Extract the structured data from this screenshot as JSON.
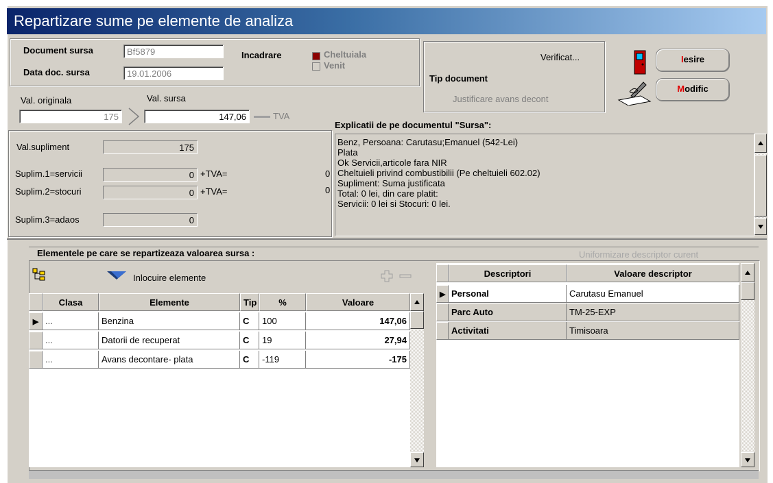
{
  "window": {
    "title": "Repartizare sume pe elemente de analiza"
  },
  "document": {
    "doc_source_label": "Document sursa",
    "doc_source_value": "Bf5879",
    "doc_date_label": "Data doc. sursa",
    "doc_date_value": "19.01.2006",
    "incadrare_label": "Incadrare",
    "option_cheltuiala": "Cheltuiala",
    "option_venit": "Venit"
  },
  "doctype": {
    "verificat": "Verificat...",
    "tip_label": "Tip document",
    "tip_value": "Justificare avans decont"
  },
  "buttons": {
    "iesire_hotkey": "I",
    "iesire_rest": "esire",
    "modific_hotkey": "M",
    "modific_rest": "odific"
  },
  "values": {
    "val_originala_label": "Val. originala",
    "val_originala": "175",
    "val_sursa_label": "Val. sursa",
    "val_sursa": "147,06",
    "tva_label": "TVA"
  },
  "supliments": {
    "val_supliment_label": "Val.supliment",
    "val_supliment": "175",
    "s1_label": "Suplim.1=servicii",
    "s1_value": "0",
    "s1_tva_label": "+TVA=",
    "s1_tva": "0",
    "s2_label": "Suplim.2=stocuri",
    "s2_value": "0",
    "s2_tva_label": "+TVA=",
    "s2_tva": "0",
    "s3_label": "Suplim.3=adaos",
    "s3_value": "0"
  },
  "explanations": {
    "title": "Explicatii de pe documentul \"Sursa\":",
    "lines": [
      "Benz, Persoana: Carutasu;Emanuel (542-Lei)",
      "Plata",
      "Ok Servicii,articole fara NIR",
      "Cheltuieli privind combustibilii (Pe cheltuieli 602.02)",
      "Supliment: Suma justificata",
      "Total: 0 lei, din care platit:",
      "Servicii: 0 lei si Stocuri: 0 lei."
    ]
  },
  "elements": {
    "section_title": "Elementele pe care se repartizeaza valoarea sursa  :",
    "uniformize": "Uniformizare descriptor curent",
    "replace_label": "Inlocuire elemente",
    "columns": [
      "Clasa",
      "Elemente",
      "Tip",
      "%",
      "Valoare"
    ],
    "rows": [
      {
        "clasa": "...",
        "element": "Benzina",
        "tip": "C",
        "pct": "100",
        "valoare": "147,06"
      },
      {
        "clasa": "...",
        "element": "Datorii de recuperat",
        "tip": "C",
        "pct": "19",
        "valoare": "27,94"
      },
      {
        "clasa": "...",
        "element": "Avans decontare- plata",
        "tip": "C",
        "pct": "-119",
        "valoare": "-175"
      }
    ]
  },
  "descriptors": {
    "columns": [
      "Descriptori",
      "Valoare descriptor"
    ],
    "rows": [
      {
        "name": "Personal",
        "value": "Carutasu Emanuel"
      },
      {
        "name": "Parc Auto",
        "value": "TM-25-EXP"
      },
      {
        "name": "Activitati",
        "value": "Timisoara"
      }
    ]
  }
}
